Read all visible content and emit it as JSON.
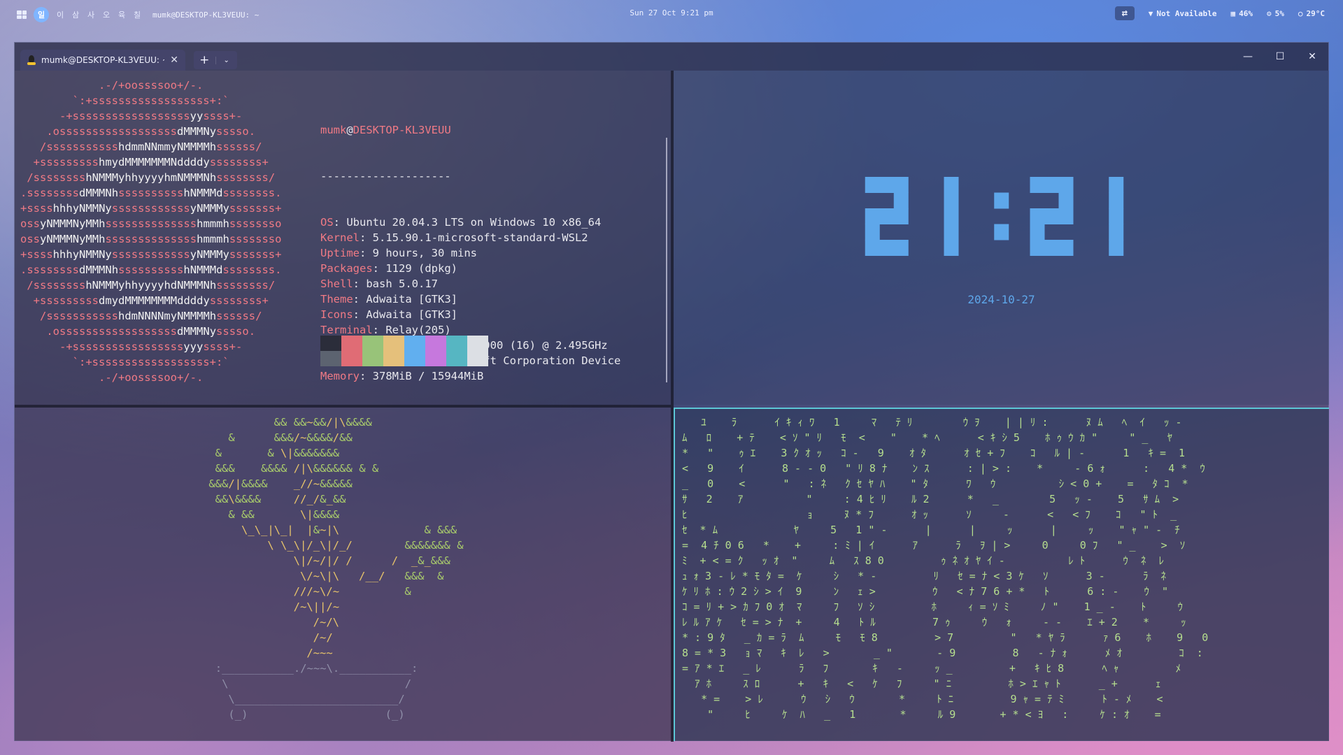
{
  "topbar": {
    "workspaces": [
      "일",
      "이",
      "삼",
      "사",
      "오",
      "육",
      "칠"
    ],
    "active_workspace": "일",
    "window_title": "mumk@DESKTOP-KL3VEUU: ~",
    "datetime": "Sun 27 Oct 9:21 pm",
    "network": "Not Available",
    "memory": "46%",
    "cpu": "5%",
    "temperature": "29°C"
  },
  "terminal": {
    "tab_title": "mumk@DESKTOP-KL3VEUU: ~",
    "new_tab": "+",
    "dropdown": "⌄",
    "minimize": "—",
    "maximize": "☐",
    "close": "✕"
  },
  "neofetch": {
    "user": "mumk",
    "at": "@",
    "host": "DESKTOP-KL3VEUU",
    "separator": "--------------------",
    "fields": [
      {
        "key": "OS",
        "value": "Ubuntu 20.04.3 LTS on Windows 10 x86_64"
      },
      {
        "key": "Kernel",
        "value": "5.15.90.1-microsoft-standard-WSL2"
      },
      {
        "key": "Uptime",
        "value": "9 hours, 30 mins"
      },
      {
        "key": "Packages",
        "value": "1129 (dpkg)"
      },
      {
        "key": "Shell",
        "value": "bash 5.0.17"
      },
      {
        "key": "Theme",
        "value": "Adwaita [GTK3]"
      },
      {
        "key": "Icons",
        "value": "Adwaita [GTK3]"
      },
      {
        "key": "Terminal",
        "value": "Relay(205)"
      },
      {
        "key": "CPU",
        "value": "11th Gen Intel i9-11900 (16) @ 2.495GHz"
      },
      {
        "key": "GPU",
        "value": "41e8:00:00.0 Microsoft Corporation Device"
      },
      {
        "key": "Memory",
        "value": "378MiB / 15944MiB"
      }
    ],
    "palette_top": [
      "#2b2d3a",
      "#e06c75",
      "#98c379",
      "#e5c07b",
      "#61afef",
      "#c678dd",
      "#56b6c2",
      "#dcdfe4"
    ],
    "palette_bottom": [
      "#5c6370",
      "#e06c75",
      "#98c379",
      "#e5c07b",
      "#61afef",
      "#c678dd",
      "#56b6c2",
      "#dcdfe4"
    ],
    "ascii_logo": [
      "            .-/+oossssoo+/-.",
      "        `:+ssssssssssssssssss+:`",
      "      -+ssssssssssssssssssyyssss+-",
      "    .ossssssssssssssssssdMMMNysssso.",
      "   /ssssssssssshdmmNNmmyNMMMMhssssss/",
      "  +ssssssssshmydMMMMMMMNddddyssssssss+",
      " /sssssssshNMMMyhhyyyyhmNMMMNhssssssss/",
      ".ssssssssdMMMNhsssssssssshNMMMdssssssss.",
      "+sssshhhyNMMNyssssssssssssyNMMMysssssss+",
      "ossyNMMMNyMMhsssssssssssssshmmmhssssssso",
      "ossyNMMMNyMMhsssssssssssssshmmmhssssssso",
      "+sssshhhyNMMNyssssssssssssyNMMMysssssss+",
      ".ssssssssdMMMNhsssssssssshNMMMdssssssss.",
      " /sssssssshNMMMyhhyyyyhdNMMMNhssssssss/",
      "  +sssssssssdmydMMMMMMMMddddyssssssss+",
      "   /ssssssssssshdmNNNNmyNMMMMhssssss/",
      "    .ossssssssssssssssssdMMMNysssso.",
      "      -+sssssssssssssssssyyyssss+-",
      "        `:+ssssssssssssssssss+:`",
      "            .-/+oossssoo+/-."
    ]
  },
  "clock": {
    "time": "21:21",
    "date": "2024-10-27",
    "color": "#5ea7ea"
  },
  "bonsai": [
    "              && &&~&&/|\\&&&&",
    "       &      &&&/~&&&&/&&",
    "     &       & \\|&&&&&&&",
    "     &&&    &&&& /|\\&&&&&& & &",
    "    &&&/|&&&&    _//~&&&&&",
    "     &&\\&&&&     //_/&_&&",
    "       & &&       \\|&&&&",
    "         \\_\\_|\\_|  |&~|\\             & &&&",
    "             \\ \\_\\|/_\\|/_/        &&&&&&& &",
    "                 \\|/~/|/ /      /  _&_&&&",
    "                  \\/~\\|\\   /__/   &&&  &",
    "                 ///~\\/~          &",
    "                 /~\\||/~",
    "                    /~/\\",
    "                    /~/",
    "                   /~~~",
    "     :___________./~~~\\.___________:",
    "      \\                           /",
    "       \\_________________________/",
    "       (_)                     (_)"
  ],
  "matrix_rain": [
    "   ﾕ    ﾗ      ｲ ｷ ｨ ﾜ   1     ﾏ   ﾃ ﾘ        ｳ ｦ    | | ﾘ :      ﾇ ﾑ   ﾍ  ｲ   ｯ -",
    "ﾑ   ﾛ    + ﾃ    < ｿ \" ﾘ   ﾓ  <    \"    * ﾍ      < ｷ ｼ 5    ﾎ ｩ ｳ ｶ \"     \" _   ﾔ",
    "*   \"    ｩ ｴ    3 ｸ ｵ ｯ   ｺ -   9    ｵ ﾀ      ｵ ｾ + ﾌ    ｺ   ﾙ | -      1   ｷ =  1",
    "<   9    ｲ      8 - - 0   \" ﾘ 8 ﾅ    ﾝ ｽ      : | > :    *     - 6 ｫ      :   4 *  ｳ",
    "_   0    <      \"   : ﾈ   ｸ ｾ ﾔ ﾊ    \" ﾀ      ﾜ   ｳ          ｼ < 0 +    =   ﾀ ｺ  *",
    "ｻ   2    ｱ          \"     : 4 ﾋ ﾘ    ﾙ 2      *   _        5   ｯ -    5   ｻ ﾑ  >",
    "ﾋ                   ｮ     ﾇ * ﾌ      ｵ ｯ      ｿ     -      <   < ﾌ    ｺ   \" ﾄ  _",
    "ｾ  * ﾑ            ﾔ     5   1 \" -      |      |     ｯ      |     ｯ    \" ｬ \" -  ﾁ",
    "=  4 ﾁ 0 6   *    +     : ﾐ | ｲ      ｱ      ﾗ   ｦ | >     0     0 ﾌ   \" _    >  ｿ",
    "ﾐ  + < = ｸ   ｯ ｵ  \"     ﾑ   ｽ 8 0         ｩ ﾈ ｵ ﾔ ｲ -          ﾚ ﾄ      ｳ  ﾈ  ﾚ",
    "ｭ ｫ 3 - ﾚ * ﾓ ﾀ =  ｹ     ｼ   * -         ﾘ   ｾ = ﾅ < 3 ｹ   ｿ      3 -      ﾗ  ﾈ",
    "ｹ ﾘ ﾎ : ｳ 2 ｼ > ｲ  9     ﾝ   ｪ >         ｳ   < ﾅ 7 6 + *   ﾄ      6 : -    ｳ  \"",
    "ｺ = ﾘ + > ｶ ﾌ 0 ｵ  ﾏ     ﾌ   ｿ ｼ         ﾎ     ｨ = ｿ ﾐ     ﾉ \"    1 _ -    ﾄ     ｳ",
    "ﾚ ﾙ ｱ ｹ   ｾ = > ﾅ  +     4   ﾄ ﾙ         7 ｩ     ｳ   ｫ     - -    ｴ + 2    *     ｯ",
    "* : 9 ﾀ   _ ｶ = ﾗ  ﾑ     ﾓ   ﾓ 8         > 7         \"   * ﾔ ﾗ      ｧ 6    ﾎ    9   0",
    "8 = * 3   ｮ ﾏ   ｷ  ﾚ   >       _ \"       - 9         8   - ﾅ ｫ      ﾒ ｵ         ｺ  :",
    "= ｱ * ｴ   _ ﾚ      ﾗ   ﾌ       ｷ   -     ｯ _         +   ｷ ﾋ 8      ﾍ ｬ         ﾒ",
    "  ｱ ﾎ     ｽ ﾛ      +   ｷ   <   ｹ   ﾌ     \" ﾆ         ﾎ > ｴ ｬ ﾄ      _ +      ｪ",
    "   * =    > ﾚ      ｳ   ｼ   ｳ       *     ﾄ ﾆ         9 ｬ = ﾃ ﾐ      ﾄ - ﾒ    <",
    "    \"     ﾋ     ｹ  ﾊ   _   1       *     ﾙ 9       + * < ﾖ   :     ｹ : ｵ    ="
  ],
  "colors": {
    "prompt_red": "#f07a85",
    "matrix_green": "#b6df8e",
    "active_border": "#5cc7d6"
  }
}
